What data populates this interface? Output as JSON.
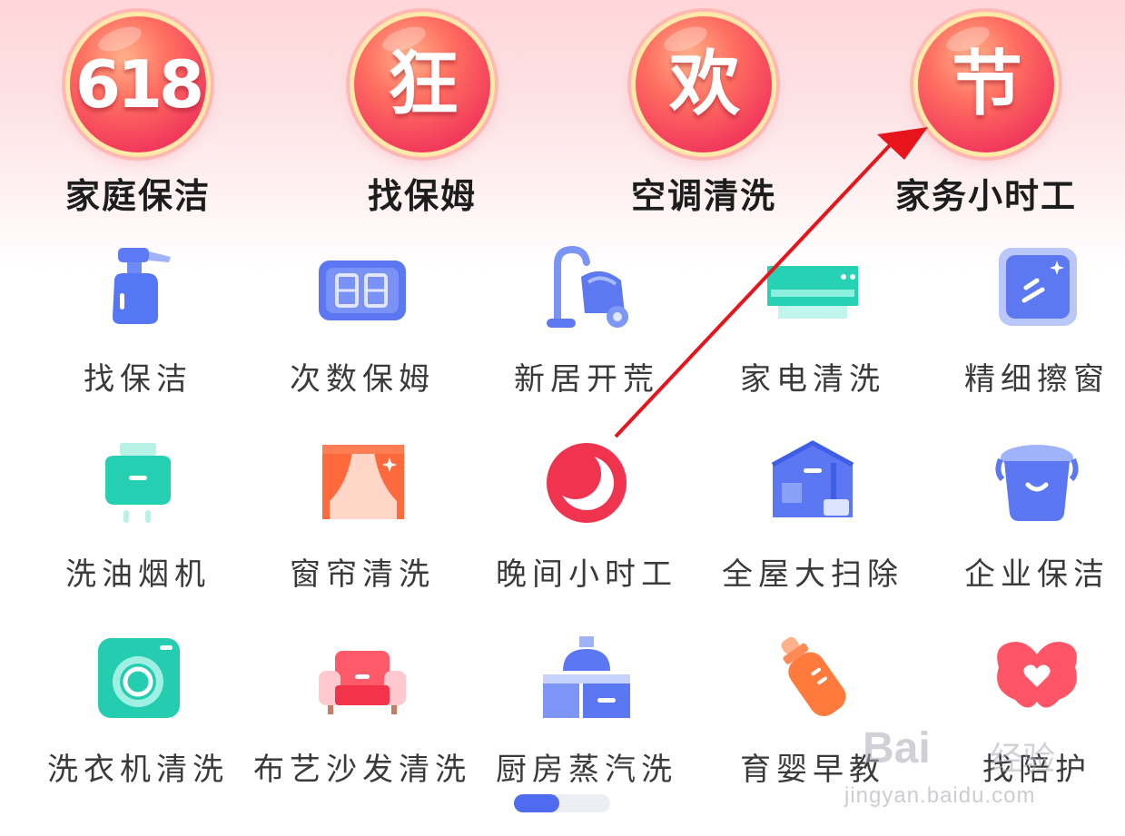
{
  "promos": [
    {
      "badge": "618",
      "label": "家庭保洁"
    },
    {
      "badge": "狂",
      "label": "找保姆"
    },
    {
      "badge": "欢",
      "label": "空调清洗"
    },
    {
      "badge": "节",
      "label": "家务小时工"
    }
  ],
  "services": [
    {
      "label": "找保洁",
      "icon": "spray-bottle-icon"
    },
    {
      "label": "次数保姆",
      "icon": "digital-counter-icon"
    },
    {
      "label": "新居开荒",
      "icon": "vacuum-cleaner-icon"
    },
    {
      "label": "家电清洗",
      "icon": "air-conditioner-icon"
    },
    {
      "label": "精细擦窗",
      "icon": "window-icon"
    },
    {
      "label": "洗油烟机",
      "icon": "range-hood-icon"
    },
    {
      "label": "窗帘清洗",
      "icon": "curtain-icon"
    },
    {
      "label": "晚间小时工",
      "icon": "moon-icon"
    },
    {
      "label": "全屋大扫除",
      "icon": "house-broom-icon"
    },
    {
      "label": "企业保洁",
      "icon": "bucket-icon"
    },
    {
      "label": "洗衣机清洗",
      "icon": "washing-machine-icon"
    },
    {
      "label": "布艺沙发清洗",
      "icon": "sofa-icon"
    },
    {
      "label": "厨房蒸汽洗",
      "icon": "kitchen-hood-icon"
    },
    {
      "label": "育婴早教",
      "icon": "baby-bottle-icon"
    },
    {
      "label": "找陪护",
      "icon": "heart-icon"
    }
  ],
  "pager": {
    "current": 1,
    "total": 2
  },
  "watermark": {
    "brand": "Bai",
    "cn": "经验",
    "url": "jingyan.baidu.com"
  },
  "colors": {
    "accent": "#4f6cf0",
    "badge_red": "#f23a5c",
    "arrow": "#e8141c"
  }
}
